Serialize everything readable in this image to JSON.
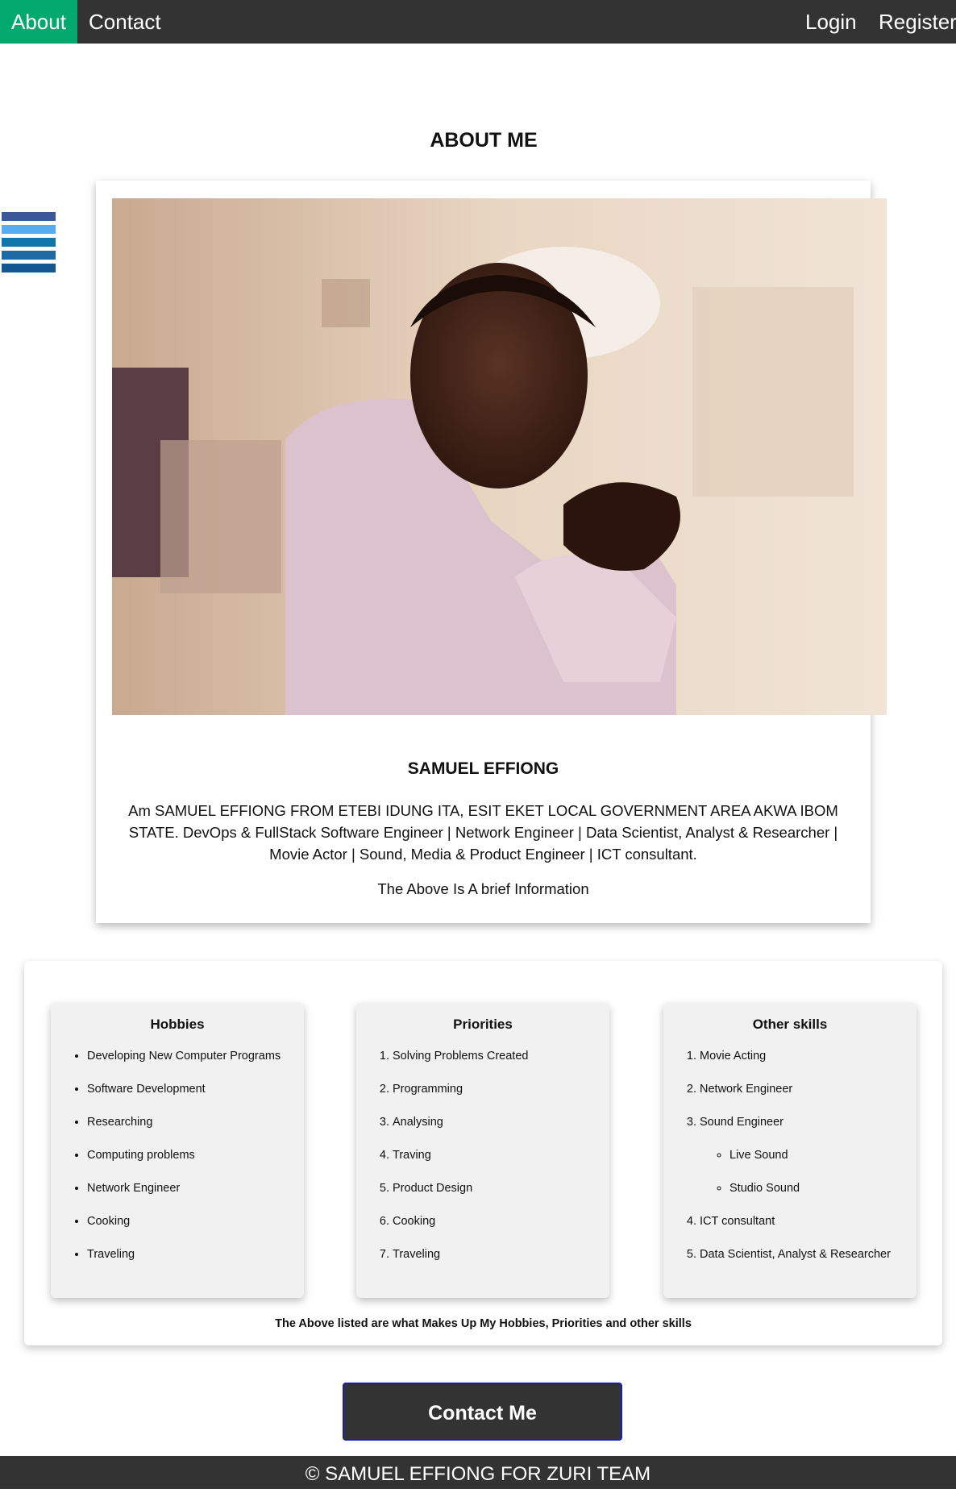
{
  "nav": {
    "about": "About",
    "contact": "Contact",
    "login": "Login",
    "register": "Register"
  },
  "social_bars": [
    "#3b5998",
    "#55acee",
    "#0e76a8",
    "#1d6aa5",
    "#12578f",
    "#0b4d87"
  ],
  "about": {
    "title": "ABOUT ME",
    "name": "SAMUEL EFFIONG",
    "bio": "Am SAMUEL EFFIONG FROM ETEBI IDUNG ITA, ESIT EKET LOCAL GOVERNMENT AREA AKWA IBOM STATE. DevOps & FullStack Software Engineer | Network Engineer | Data Scientist, Analyst & Researcher | Movie Actor | Sound, Media & Product Engineer | ICT consultant.",
    "brief": "The Above Is A brief Information"
  },
  "hobbies": {
    "title": "Hobbies",
    "items": [
      "Developing New Computer Programs",
      "Software Development",
      "Researching",
      "Computing problems",
      "Network Engineer",
      "Cooking",
      "Traveling"
    ]
  },
  "priorities": {
    "title": "Priorities",
    "items": [
      "Solving Problems Created",
      "Programming",
      "Analysing",
      "Traving",
      "Product Design",
      "Cooking",
      "Traveling"
    ]
  },
  "other_skills": {
    "title": "Other skills",
    "items": [
      "Movie Acting",
      "Network Engineer",
      "Sound Engineer",
      "ICT consultant",
      "Data Scientist, Analyst & Researcher"
    ],
    "sound_sub": [
      "Live Sound",
      "Studio Sound"
    ]
  },
  "skills_note": "The Above listed are what Makes Up My Hobbies, Priorities and other skills",
  "contact_button": "Contact Me",
  "footer": "© SAMUEL EFFIONG FOR ZURI TEAM",
  "colors": {
    "nav_bg": "#333333",
    "nav_active": "#04AA6D",
    "button_border": "#1b1bb4"
  }
}
